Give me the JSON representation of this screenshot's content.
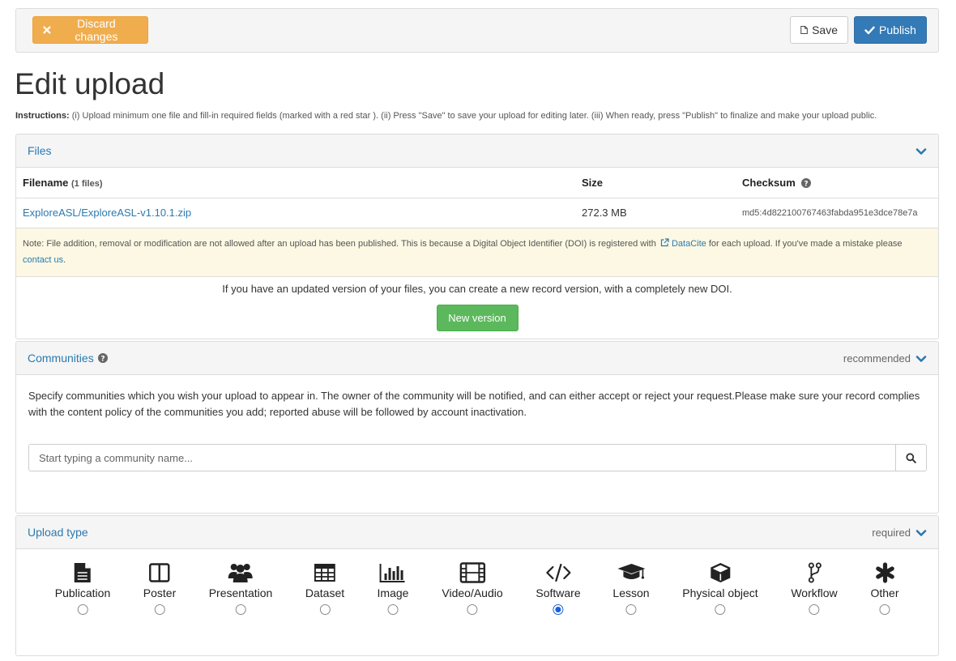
{
  "toolbar": {
    "discard_label": "Discard changes",
    "save_label": "Save",
    "publish_label": "Publish"
  },
  "page": {
    "title": "Edit upload",
    "instructions_label": "Instructions:",
    "instructions_text": "(i) Upload minimum one file and fill-in required fields (marked with a red star ). (ii) Press \"Save\" to save your upload for editing later. (iii) When ready, press \"Publish\" to finalize and make your upload public."
  },
  "files": {
    "heading": "Files",
    "col_filename": "Filename",
    "file_count": "(1 files)",
    "col_size": "Size",
    "col_checksum": "Checksum",
    "rows": [
      {
        "filename": "ExploreASL/ExploreASL-v1.10.1.zip",
        "size": "272.3 MB",
        "checksum": "md5:4d822100767463fabda951e3dce78e7a"
      }
    ],
    "note_before": "Note: File addition, removal or modification are not allowed after an upload has been published. This is because a Digital Object Identifier (DOI) is registered with",
    "note_link": "DataCite",
    "note_after": "for each upload. If you've made a mistake please",
    "note_contact": "contact us",
    "note_end": ".",
    "version_text": "If you have an updated version of your files, you can create a new record version, with a completely new DOI.",
    "new_version_label": "New version"
  },
  "communities": {
    "heading": "Communities",
    "badge": "recommended",
    "description": "Specify communities which you wish your upload to appear in. The owner of the community will be notified, and can either accept or reject your request.Please make sure your record complies with the content policy of the communities you add; reported abuse will be followed by account inactivation.",
    "search_placeholder": "Start typing a community name..."
  },
  "upload_type": {
    "heading": "Upload type",
    "badge": "required",
    "selected": "Software",
    "types": [
      {
        "label": "Publication",
        "icon": "document-icon"
      },
      {
        "label": "Poster",
        "icon": "poster-icon"
      },
      {
        "label": "Presentation",
        "icon": "group-icon"
      },
      {
        "label": "Dataset",
        "icon": "table-icon"
      },
      {
        "label": "Image",
        "icon": "bar-chart-icon"
      },
      {
        "label": "Video/Audio",
        "icon": "film-icon"
      },
      {
        "label": "Software",
        "icon": "code-icon"
      },
      {
        "label": "Lesson",
        "icon": "graduation-cap-icon"
      },
      {
        "label": "Physical object",
        "icon": "cube-icon"
      },
      {
        "label": "Workflow",
        "icon": "fork-icon"
      },
      {
        "label": "Other",
        "icon": "asterisk-icon"
      }
    ]
  },
  "colors": {
    "warning": "#f0ad4e",
    "primary": "#337ab7",
    "success": "#5cb85c",
    "link": "#2a7ab0",
    "note_bg": "#fcf8e3"
  }
}
